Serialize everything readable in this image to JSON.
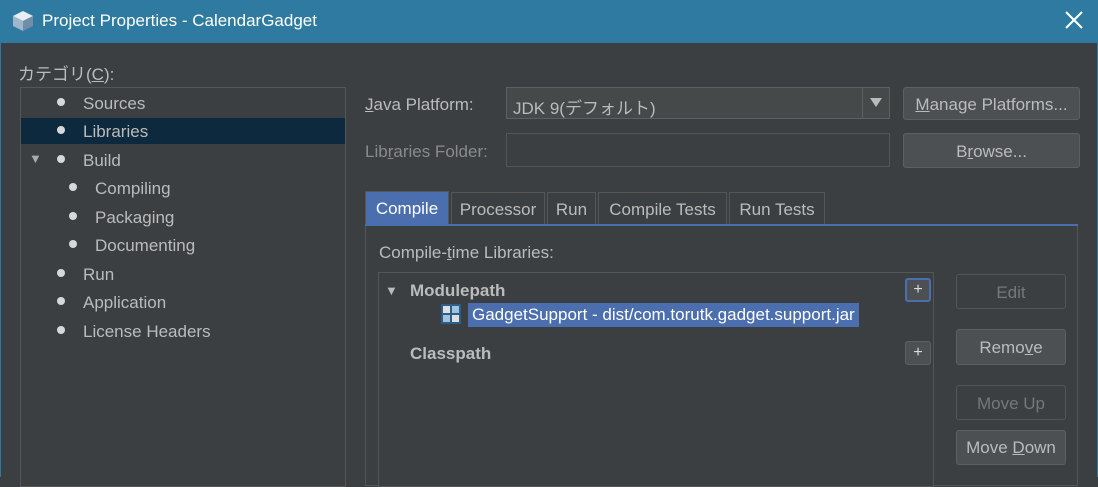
{
  "window": {
    "title": "Project Properties - CalendarGadget"
  },
  "categories": {
    "label": "カテゴリ(C):",
    "items": [
      {
        "label": "Sources",
        "level": 0,
        "selected": false
      },
      {
        "label": "Libraries",
        "level": 0,
        "selected": true
      },
      {
        "label": "Build",
        "level": 0,
        "expanded": true
      },
      {
        "label": "Compiling",
        "level": 1
      },
      {
        "label": "Packaging",
        "level": 1
      },
      {
        "label": "Documenting",
        "level": 1
      },
      {
        "label": "Run",
        "level": 0
      },
      {
        "label": "Application",
        "level": 0
      },
      {
        "label": "License Headers",
        "level": 0
      }
    ]
  },
  "platform": {
    "label": "Java Platform:",
    "value": "JDK 9(デフォルト)",
    "manage_button": "Manage Platforms..."
  },
  "libraries_folder": {
    "label": "Libraries Folder:",
    "value": "",
    "browse_button": "Browse..."
  },
  "tabs": [
    {
      "label": "Compile",
      "active": true
    },
    {
      "label": "Processor"
    },
    {
      "label": "Run"
    },
    {
      "label": "Compile Tests"
    },
    {
      "label": "Run Tests"
    }
  ],
  "compile_panel": {
    "heading": "Compile-time Libraries:",
    "modulepath": {
      "label": "Modulepath",
      "entries": [
        "GadgetSupport - dist/com.torutk.gadget.support.jar"
      ]
    },
    "classpath": {
      "label": "Classpath"
    },
    "plus": "+",
    "buttons": {
      "edit": "Edit",
      "remove": "Remove",
      "move_up": "Move Up",
      "move_down": "Move Down"
    }
  },
  "colors": {
    "titlebar": "#2f7aa0",
    "background": "#3c3f41",
    "selection": "#4b6eaf",
    "tree_selection": "#0d293e"
  }
}
